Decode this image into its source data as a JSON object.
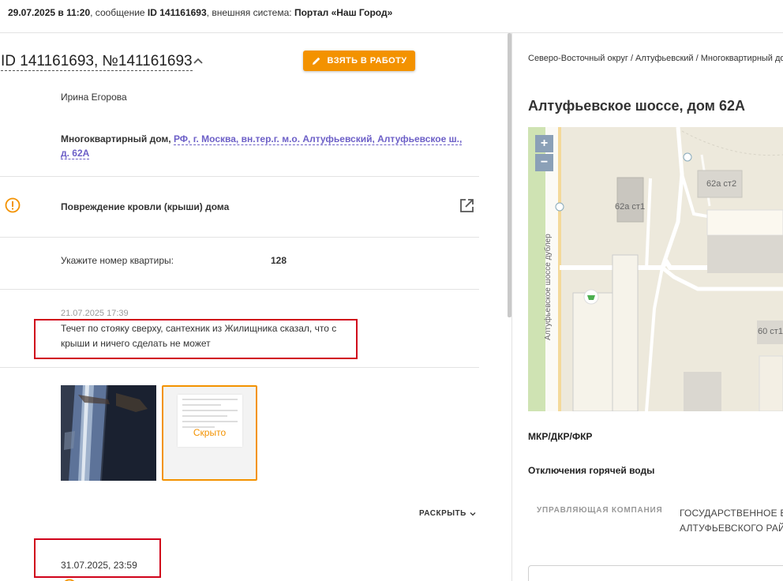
{
  "header": {
    "datetime": "29.07.2025 в 11:20",
    "message_label": ", сообщение ",
    "message_id": "ID 141161693",
    "external_label": ", внешняя система: ",
    "external_system": "Портал «Наш Город»"
  },
  "ticket": {
    "title": "ID 141161693, №141161693",
    "take_button": "ВЗЯТЬ В РАБОТУ",
    "applicant": "Ирина Егорова",
    "object_type": "Многоквартирный дом",
    "address": "РФ, г. Москва, вн.тер.г. м.о. Алтуфьевский, Алтуфьевское ш., д. 62А",
    "issue": "Повреждение кровли (крыши) дома",
    "apartment_label": "Укажите номер квартиры:",
    "apartment_value": "128",
    "comment_date": "21.07.2025 17:39",
    "comment_text": "Течет по стояку сверху, сантехник из Жилищника сказал, что с крыши и ничего сделать не может",
    "hidden_label": "Скрыто",
    "expand_label": "РАСКРЫТЬ",
    "second_date": "31.07.2025, 23:59"
  },
  "location": {
    "breadcrumb": "Северо-Восточный округ / Алтуфьевский / Многоквартирный дом",
    "address_title": "Алтуфьевское шоссе, дом 62А",
    "map": {
      "zoom_in": "+",
      "zoom_out": "−",
      "street": "Алтуфьевское шоссе дублер",
      "building1": "62а ст1",
      "building2": "62а ст2",
      "building3": "60 ст1"
    },
    "mkr": "МКР/ДКР/ФКР",
    "hot_water": "Отключения горячей воды",
    "mc_label": "УПРАВЛЯЮЩАЯ КОМПАНИЯ",
    "mc_value_line1": "ГОСУДАРСТВЕННОЕ БЮ",
    "mc_value_line2": "АЛТУФЬЕВСКОГО РАЙО"
  },
  "colors": {
    "accent": "#f39200",
    "link": "#6c5fc7",
    "highlight": "#d0021b"
  }
}
